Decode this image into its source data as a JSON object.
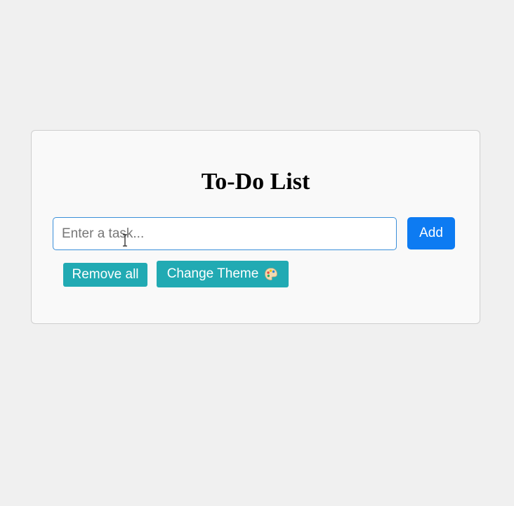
{
  "app": {
    "title": "To-Do List"
  },
  "task_input": {
    "value": "",
    "placeholder": "Enter a task..."
  },
  "buttons": {
    "add_label": "Add",
    "remove_all_label": "Remove all",
    "change_theme_label": "Change Theme"
  },
  "icons": {
    "theme": "palette-icon",
    "cursor": "text-cursor-icon"
  },
  "colors": {
    "background": "#f0f0f0",
    "card": "#f9f9f9",
    "add_button": "#0d7bf2",
    "action_button": "#21aab3",
    "input_border": "#3a8fd9"
  }
}
